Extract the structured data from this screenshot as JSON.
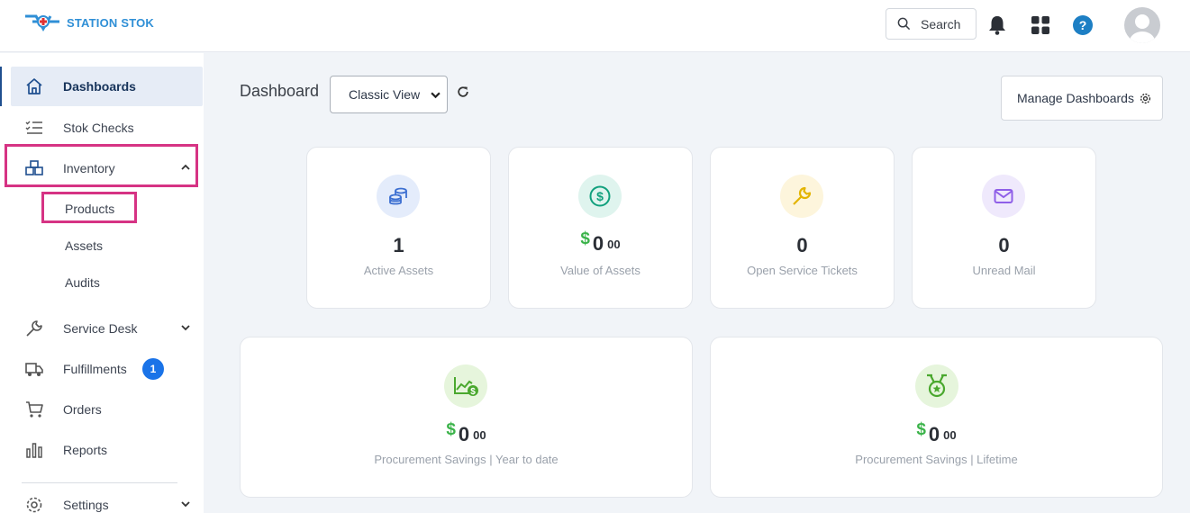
{
  "app": {
    "logo_text": "STATION STOK",
    "search_label": "Search"
  },
  "sidebar": {
    "items": [
      {
        "label": "Dashboards"
      },
      {
        "label": "Stok Checks"
      },
      {
        "label": "Inventory"
      },
      {
        "label": "Service Desk"
      },
      {
        "label": "Fulfillments",
        "badge": "1"
      },
      {
        "label": "Orders"
      },
      {
        "label": "Reports"
      },
      {
        "label": "Settings"
      }
    ],
    "inventory_sub": [
      {
        "label": "Products"
      },
      {
        "label": "Assets"
      },
      {
        "label": "Audits"
      }
    ]
  },
  "main": {
    "title": "Dashboard",
    "view_select": {
      "selected": "Classic View"
    },
    "manage_label": "Manage Dashboards",
    "cards": [
      {
        "value": "1",
        "caption": "Active Assets",
        "icon": "coins-icon"
      },
      {
        "dollar": "$",
        "value": "0",
        "cents": "00",
        "caption": "Value of Assets",
        "icon": "dollar-circle-icon"
      },
      {
        "value": "0",
        "caption": "Open Service Tickets",
        "icon": "wrench-icon"
      },
      {
        "value": "0",
        "caption": "Unread Mail",
        "icon": "mail-icon"
      }
    ],
    "savings": [
      {
        "dollar": "$",
        "value": "0",
        "cents": "00",
        "caption": "Procurement Savings | Year to date",
        "icon": "savings-chart-icon"
      },
      {
        "dollar": "$",
        "value": "0",
        "cents": "00",
        "caption": "Procurement Savings | Lifetime",
        "icon": "medal-icon"
      }
    ]
  },
  "colors": {
    "accent": "#1a73e8",
    "highlight": "#d63384",
    "money_green": "#3bb34a"
  }
}
